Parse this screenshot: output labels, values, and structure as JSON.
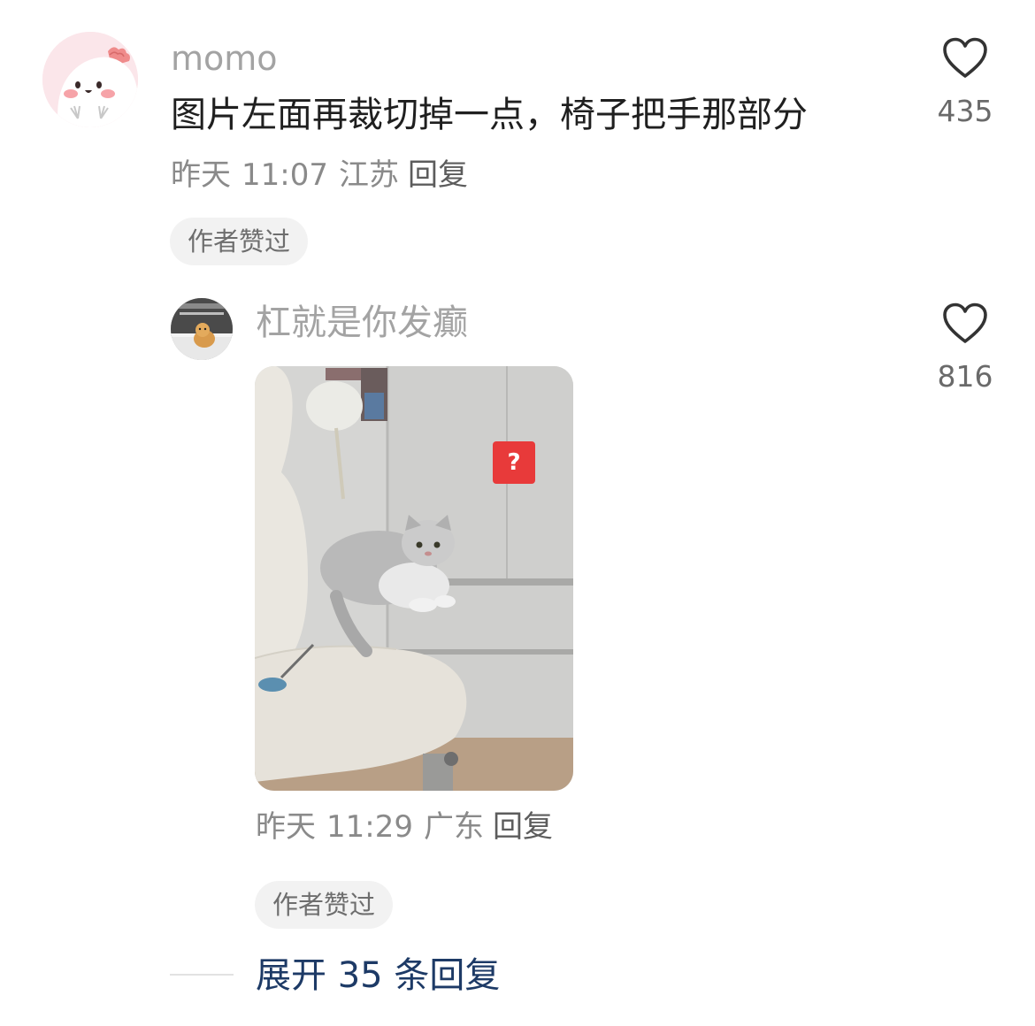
{
  "comment": {
    "username": "momo",
    "text": "图片左面再裁切掉一点，椅子把手那部分",
    "date": "昨天",
    "time": "11:07",
    "location": "江苏",
    "reply_label": "回复",
    "author_badge": "作者赞过",
    "like_count": "435",
    "avatar_icon": "pink-cartoon-avatar",
    "like_icon": "heart-outline-icon"
  },
  "reply": {
    "username": "杠就是你发癫",
    "date": "昨天",
    "time": "11:29",
    "location": "广东",
    "reply_label": "回复",
    "author_badge": "作者赞过",
    "like_count": "816",
    "avatar_icon": "cat-photo-avatar",
    "image_icon": "cat-on-chair-photo",
    "sticker_text": "?",
    "like_icon": "heart-outline-icon"
  },
  "expand": {
    "label": "展开 35 条回复"
  },
  "colors": {
    "link": "#1d3a66",
    "sticker": "#e83a3a"
  }
}
